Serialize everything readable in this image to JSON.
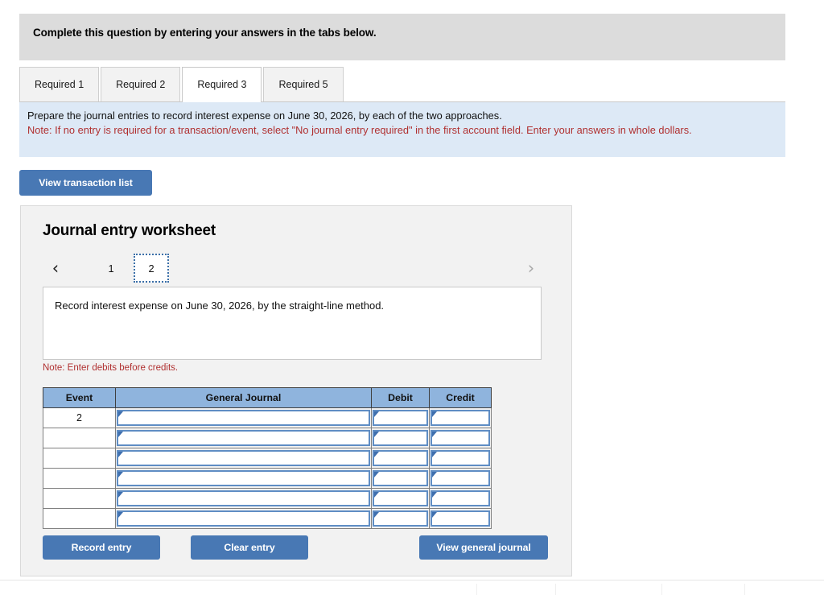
{
  "header": {
    "banner_text": "Complete this question by entering your answers in the tabs below."
  },
  "tabs": [
    {
      "label": "Required 1",
      "active": false
    },
    {
      "label": "Required 2",
      "active": false
    },
    {
      "label": "Required 3",
      "active": true
    },
    {
      "label": "Required 5",
      "active": false
    }
  ],
  "instructions": {
    "line1": "Prepare the journal entries to record interest expense on June 30, 2026, by each of the two approaches.",
    "note": "Note: If no entry is required for a transaction/event, select \"No journal entry required\" in the first account field. Enter your answers in whole dollars."
  },
  "toolbar": {
    "view_transaction_list_label": "View transaction list"
  },
  "worksheet": {
    "title": "Journal entry worksheet",
    "pager": {
      "prev_icon": "‹",
      "next_icon": "›",
      "pages": [
        "1",
        "2"
      ],
      "selected_page": "2"
    },
    "description": "Record interest expense on June 30, 2026, by the straight-line method.",
    "debits_note": "Note: Enter debits before credits.",
    "table": {
      "columns": [
        "Event",
        "General Journal",
        "Debit",
        "Credit"
      ],
      "rows": [
        {
          "event": "2",
          "general_journal": "",
          "debit": "",
          "credit": ""
        },
        {
          "event": "",
          "general_journal": "",
          "debit": "",
          "credit": ""
        },
        {
          "event": "",
          "general_journal": "",
          "debit": "",
          "credit": ""
        },
        {
          "event": "",
          "general_journal": "",
          "debit": "",
          "credit": ""
        },
        {
          "event": "",
          "general_journal": "",
          "debit": "",
          "credit": ""
        },
        {
          "event": "",
          "general_journal": "",
          "debit": "",
          "credit": ""
        }
      ]
    },
    "actions": {
      "record_entry_label": "Record entry",
      "clear_entry_label": "Clear entry",
      "view_general_journal_label": "View general journal"
    }
  },
  "colors": {
    "accent_blue": "#4878b4",
    "table_header_blue": "#8fb4dd",
    "instruction_bg": "#dde9f6",
    "note_red": "#b03030",
    "banner_gray": "#dcdcdc",
    "panel_gray": "#f2f2f2"
  }
}
